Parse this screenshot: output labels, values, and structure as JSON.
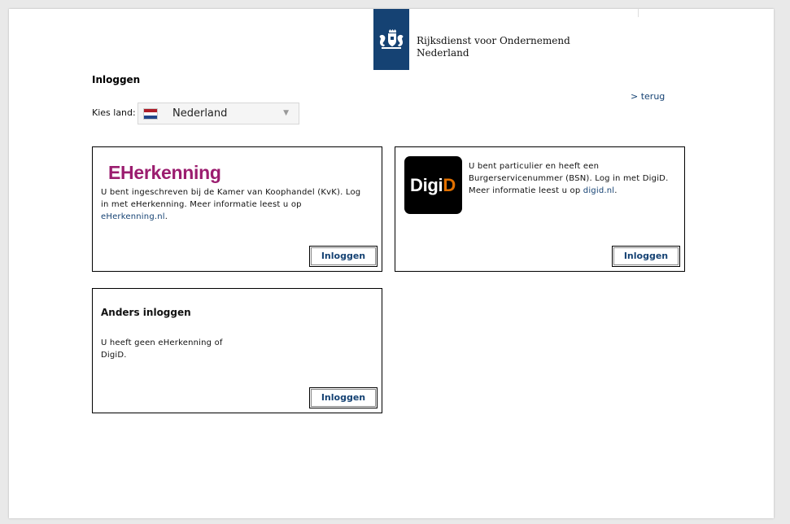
{
  "header": {
    "logo_line1": "Rijksdienst voor Ondernemend",
    "logo_line2": "Nederland"
  },
  "page_title": "Inloggen",
  "back_link": "> terug",
  "country": {
    "label": "Kies land:",
    "selected": "Nederland",
    "flag_colors": [
      "#ae1c28",
      "#ffffff",
      "#21468b"
    ]
  },
  "cards": {
    "eherkenning": {
      "logo_prefix": "E",
      "logo_text": "Herkenning",
      "text": "U bent ingeschreven bij de Kamer van Koophandel (KvK). Log in met eHerkenning. Meer informatie leest u op ",
      "link": "eHerkenning.nl",
      "link_suffix": ".",
      "button": "Inloggen"
    },
    "digid": {
      "logo_part1": "Digi",
      "logo_part2": "D",
      "text": "U bent particulier en heeft een Burgerservicenummer (BSN). Log in met DigiD. Meer informatie leest u op ",
      "link": "digid.nl",
      "link_suffix": ".",
      "button": "Inloggen"
    },
    "anders": {
      "title": "Anders inloggen",
      "text": "U heeft geen eHerkenning of DigiD.",
      "button": "Inloggen"
    }
  },
  "colors": {
    "brand_blue": "#154273",
    "eherkenning_magenta": "#9b1d6f",
    "digid_orange": "#e17000"
  }
}
